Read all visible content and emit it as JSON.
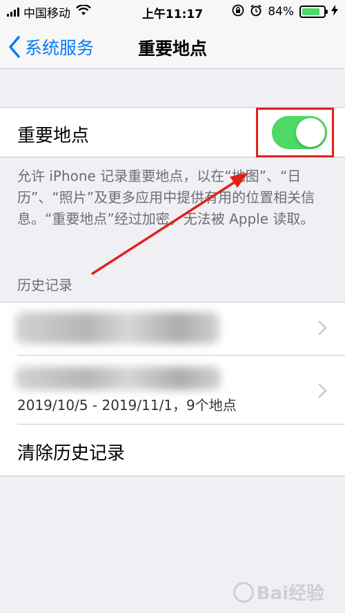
{
  "status_bar": {
    "carrier": "中国移动",
    "time": "上午11:17",
    "battery": "84%",
    "battery_level": 0.84
  },
  "nav": {
    "back_label": "系统服务",
    "title": "重要地点"
  },
  "toggle_row": {
    "label": "重要地点",
    "enabled": true
  },
  "description": "允许 iPhone 记录重要地点，以在“地图”、“日历”、“照片”及更多应用中提供有用的位置相关信息。“重要地点”经过加密，无法被 Apple 读取。",
  "history": {
    "header": "历史记录",
    "items": [
      {
        "title": "",
        "subtitle": ""
      },
      {
        "title": "",
        "subtitle": "2019/10/5 - 2019/11/1，9个地点"
      }
    ],
    "clear_label": "清除历史记录"
  },
  "watermark": "Bai经验",
  "colors": {
    "accent": "#007aff",
    "toggle_on": "#4cd964",
    "annotation": "#e0201a"
  }
}
